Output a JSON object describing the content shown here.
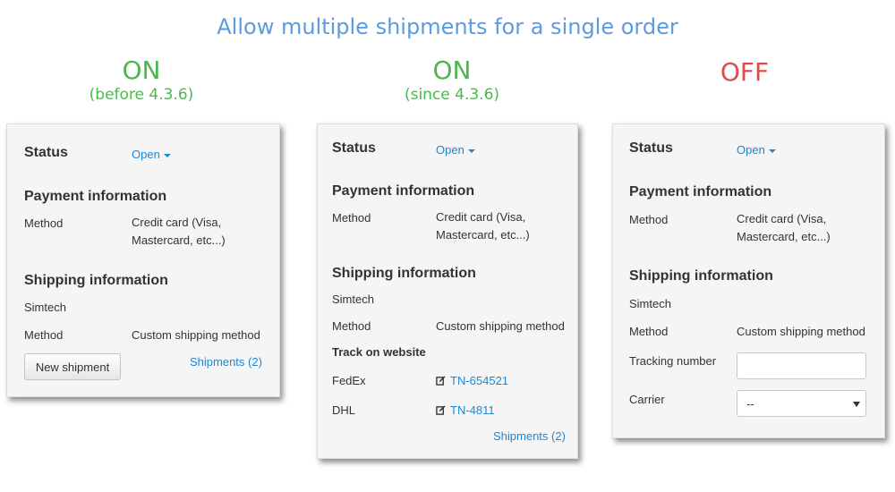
{
  "title": "Allow multiple shipments for a single order",
  "columns": [
    {
      "state": "ON",
      "note": "(before 4.3.6)"
    },
    {
      "state": "ON",
      "note": "(since 4.3.6)"
    },
    {
      "state": "OFF"
    }
  ],
  "panel1": {
    "status_label": "Status",
    "status_value": "Open",
    "payment_heading": "Payment information",
    "payment_method_label": "Method",
    "payment_method_line1": "Credit card (Visa,",
    "payment_method_line2": "Mastercard, etc...)",
    "shipping_heading": "Shipping information",
    "vendor": "Simtech",
    "shipping_method_label": "Method",
    "shipping_method_value": "Custom shipping method",
    "new_shipment_button": "New shipment",
    "shipments_link": "Shipments (2)"
  },
  "panel2": {
    "status_label": "Status",
    "status_value": "Open",
    "payment_heading": "Payment information",
    "payment_method_label": "Method",
    "payment_method_line1": "Credit card (Visa,",
    "payment_method_line2": "Mastercard, etc...)",
    "shipping_heading": "Shipping information",
    "vendor": "Simtech",
    "shipping_method_label": "Method",
    "shipping_method_value": "Custom shipping method",
    "track_heading": "Track on website",
    "tracking": [
      {
        "carrier": "FedEx",
        "number": "TN-654521"
      },
      {
        "carrier": "DHL",
        "number": "TN-4811"
      }
    ],
    "shipments_link": "Shipments (2)"
  },
  "panel3": {
    "status_label": "Status",
    "status_value": "Open",
    "payment_heading": "Payment information",
    "payment_method_label": "Method",
    "payment_method_line1": "Credit card (Visa,",
    "payment_method_line2": "Mastercard, etc...)",
    "shipping_heading": "Shipping information",
    "vendor": "Simtech",
    "shipping_method_label": "Method",
    "shipping_method_value": "Custom shipping method",
    "tracking_number_label": "Tracking number",
    "tracking_number_value": "",
    "carrier_label": "Carrier",
    "carrier_selected": "--"
  },
  "colors": {
    "title": "#5b9bdf",
    "on": "#4cb84c",
    "off": "#dd4b4b",
    "link": "#1e87d1",
    "panel_bg": "#f5f5f5"
  }
}
